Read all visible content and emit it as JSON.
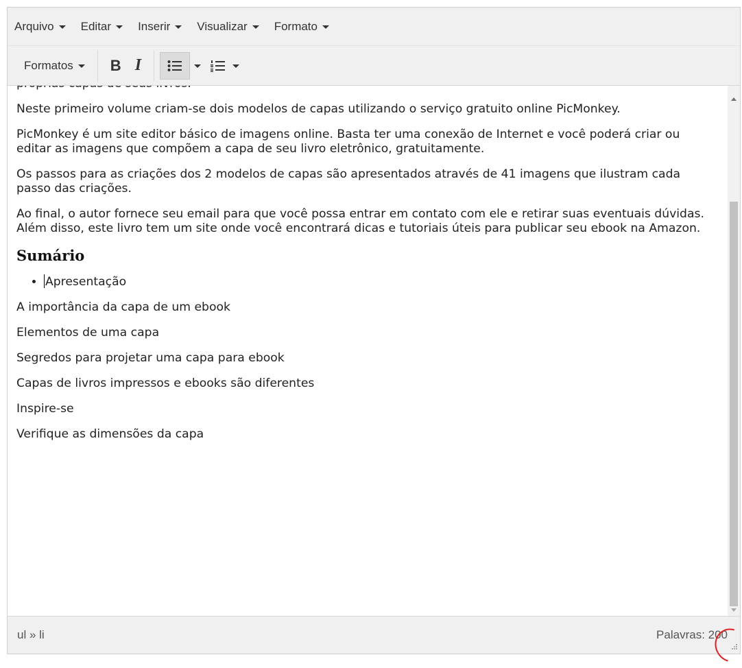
{
  "menubar": {
    "items": [
      {
        "label": "Arquivo"
      },
      {
        "label": "Editar"
      },
      {
        "label": "Inserir"
      },
      {
        "label": "Visualizar"
      },
      {
        "label": "Formato"
      }
    ]
  },
  "toolbar": {
    "formats_label": "Formatos",
    "bold_label": "B",
    "italic_label": "I",
    "bullet_list_icon": "bullet-list-icon",
    "numbered_list_icon": "numbered-list-icon"
  },
  "content": {
    "partial_line": "próprias capas de seus livros.",
    "paragraphs": [
      "Neste primeiro volume criam-se dois modelos de capas utilizando o serviço gratuito online PicMonkey.",
      "PicMonkey é um site editor básico de imagens online. Basta ter uma conexão de Internet e você poderá criar ou editar as imagens que compõem a capa de seu livro eletrônico, gratuitamente.",
      "Os passos para as criações dos 2 modelos de capas são apresentados através de 41 imagens que ilustram cada passo das criações.",
      "Ao final, o autor fornece seu email para que você possa entrar em contato com ele e retirar suas eventuais dúvidas. Além disso, este livro tem um site onde você encontrará dicas e tutoriais úteis para publicar seu ebook na Amazon."
    ],
    "heading": "Sumário",
    "list_item": "Apresentação",
    "toc": [
      "A importância da capa de um ebook",
      "Elementos de uma capa",
      "Segredos para projetar uma capa para ebook",
      "Capas de livros impressos e ebooks são diferentes",
      "Inspire-se",
      "Verifique as dimensões da capa"
    ]
  },
  "statusbar": {
    "path": "ul » li",
    "word_count": "Palavras: 200"
  },
  "colors": {
    "bar_bg": "#f0f0f0",
    "active_button": "#dcdcdc",
    "annotation": "#e02020"
  }
}
